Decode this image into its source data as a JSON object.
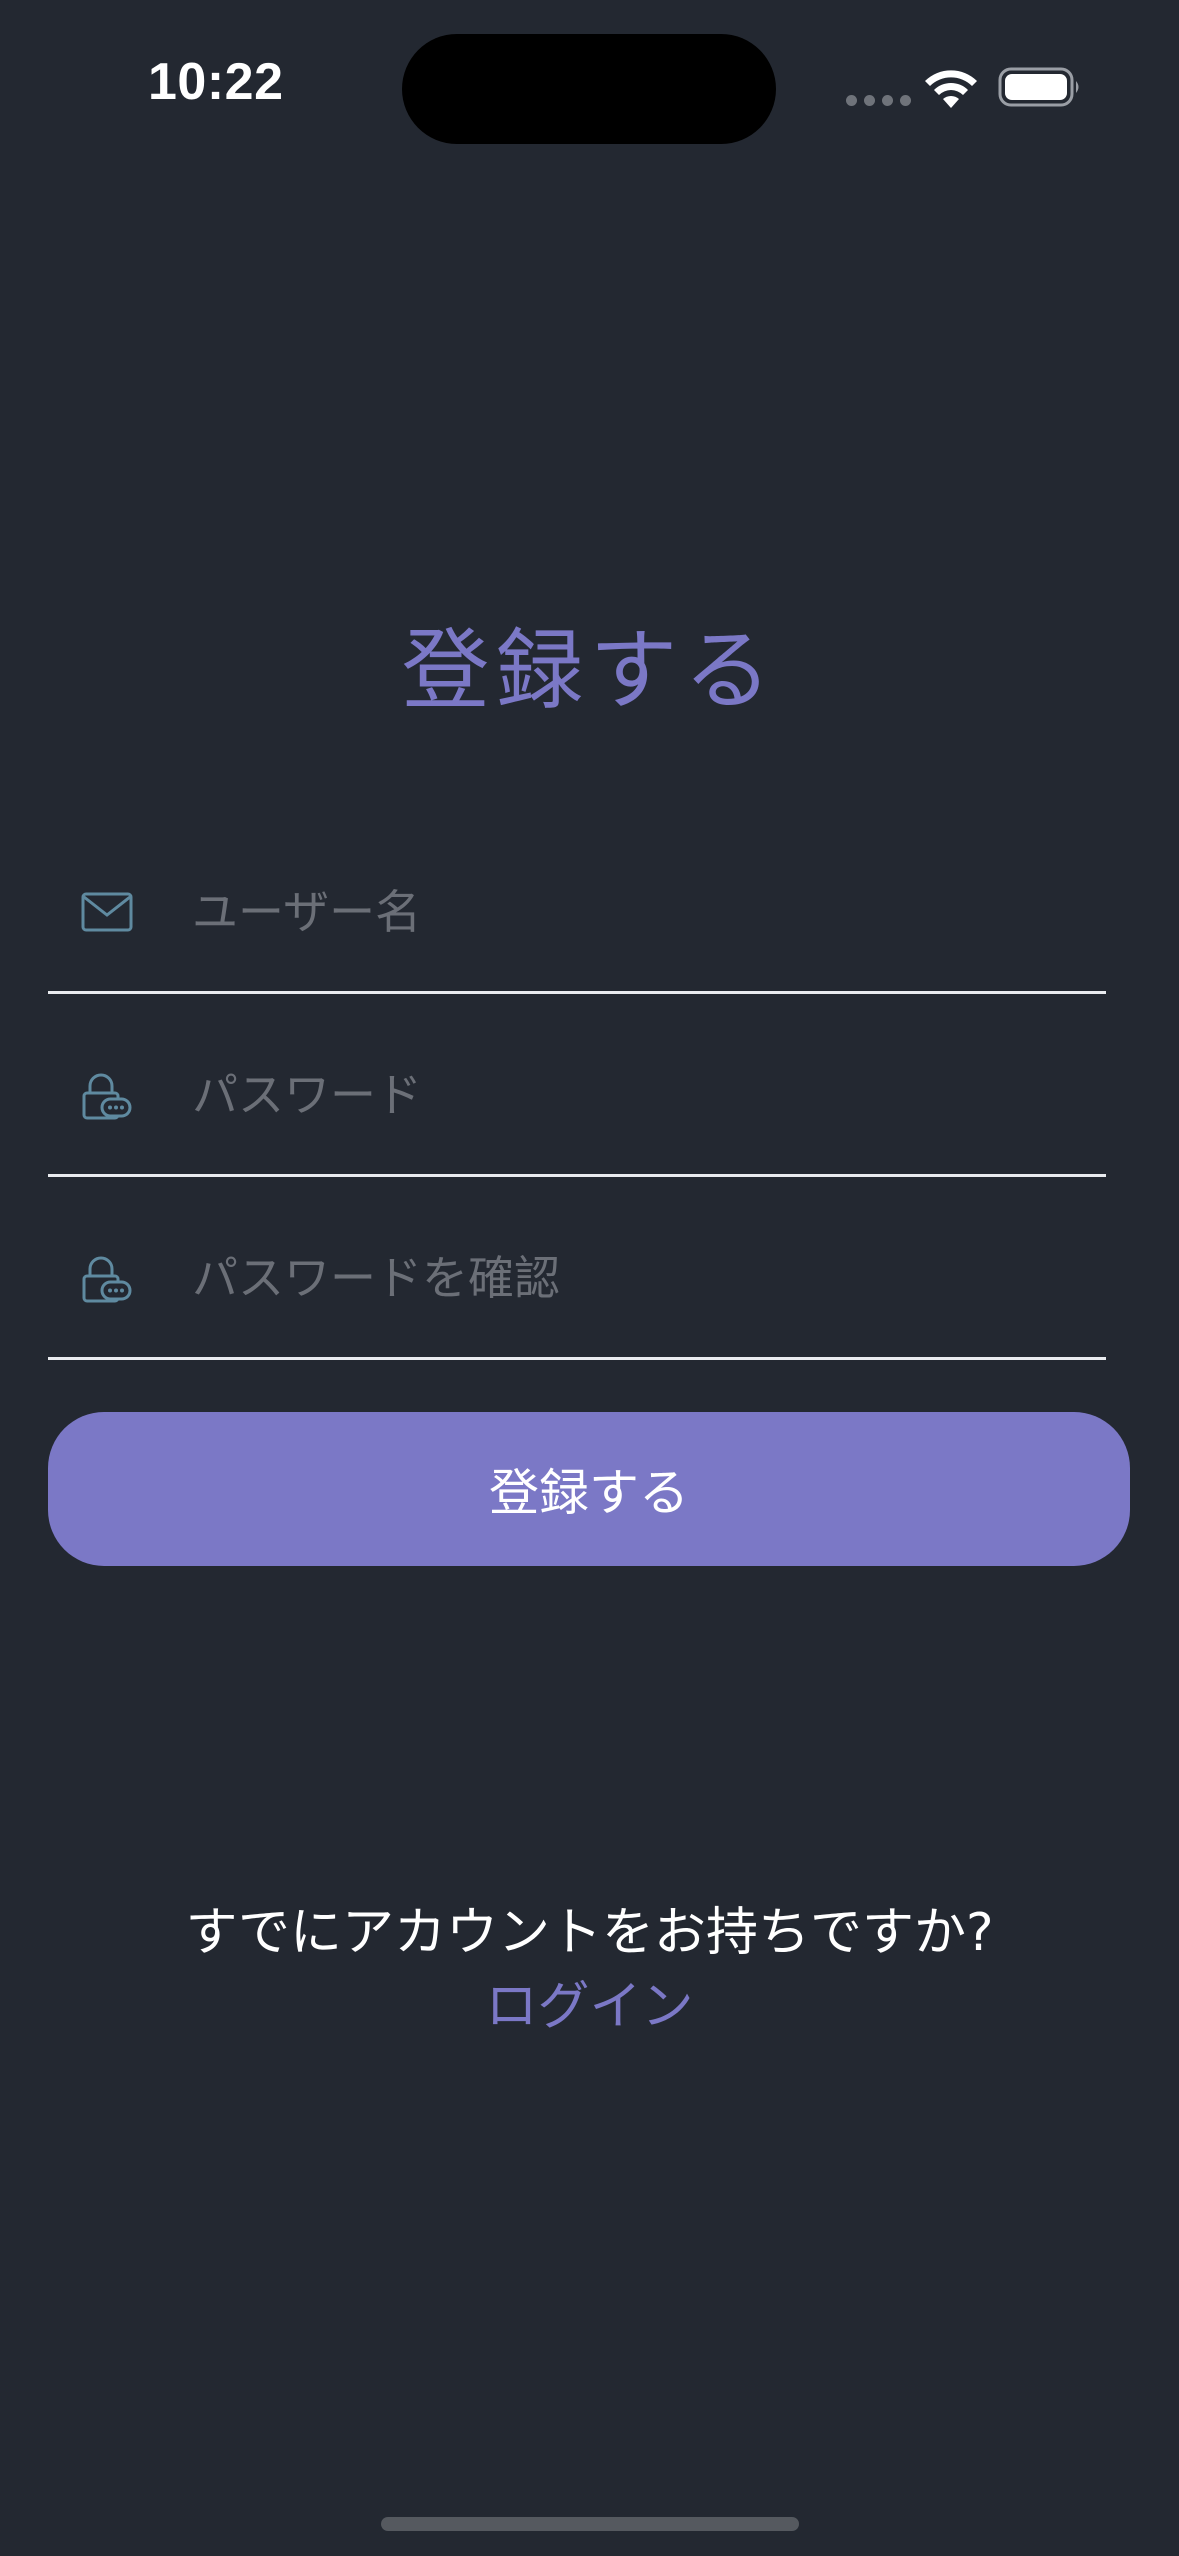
{
  "status_bar": {
    "time": "10:22"
  },
  "register": {
    "title": "登録する",
    "username_placeholder": "ユーザー名",
    "password_placeholder": "パスワード",
    "confirm_password_placeholder": "パスワードを確認",
    "submit_label": "登録する",
    "existing_account_prompt": "すでにアカウントをお持ちですか?",
    "login_link": "ログイン"
  },
  "icons": {
    "username": "envelope-icon",
    "password": "lock-icon",
    "confirm_password": "lock-icon"
  },
  "colors": {
    "background": "#232831",
    "accent": "#7b78c6",
    "icon": "#5f8aa0"
  }
}
